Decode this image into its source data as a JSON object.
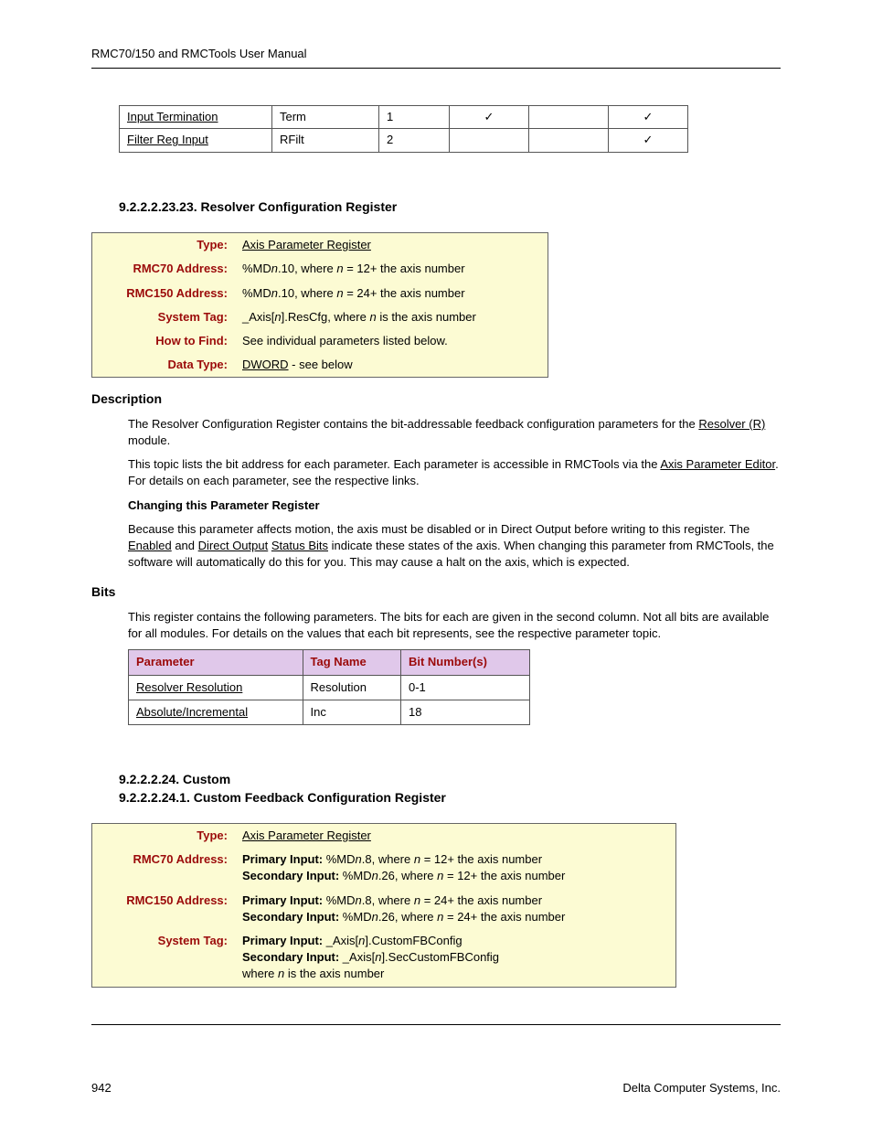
{
  "header": {
    "title": "RMC70/150 and RMCTools User Manual"
  },
  "topTable": {
    "rows": [
      {
        "param": "Input Termination",
        "tag": "Term",
        "bits": "1",
        "c1": "✓",
        "c2": "",
        "c3": "✓"
      },
      {
        "param": "Filter Reg Input",
        "tag": "RFilt",
        "bits": "2",
        "c1": "",
        "c2": "",
        "c3": "✓"
      }
    ]
  },
  "section1": {
    "heading": "9.2.2.2.23.23. Resolver Configuration Register",
    "box": {
      "type_label": "Type:",
      "type_val": "Axis Parameter Register",
      "rmc70_label": "RMC70 Address:",
      "rmc70_pre": "%MD",
      "rmc70_mid": ".10, where ",
      "rmc70_eq": " = 12+ the axis number",
      "rmc150_label": "RMC150 Address:",
      "rmc150_pre": "%MD",
      "rmc150_mid": ".10, where ",
      "rmc150_eq": " = 24+ the axis number",
      "systag_label": "System Tag:",
      "systag_pre": "_Axis[",
      "systag_post": "].ResCfg, where ",
      "systag_end": " is the axis number",
      "howto_label": "How to Find:",
      "howto_val": "See individual parameters listed below.",
      "datatype_label": "Data Type:",
      "datatype_link": "DWORD",
      "datatype_rest": " - see below"
    },
    "desc_h": "Description",
    "desc_p1a": "The Resolver Configuration Register contains the bit-addressable feedback configuration parameters for the ",
    "desc_p1_link": "Resolver (R)",
    "desc_p1b": " module.",
    "desc_p2a": "This topic lists the bit address for each parameter. Each parameter is accessible in RMCTools via the ",
    "desc_p2_link": "Axis Parameter Editor",
    "desc_p2b": ". For details on each parameter, see the respective links.",
    "change_h": "Changing this Parameter Register",
    "change_p_a": "Because this parameter affects motion, the axis must be disabled or in Direct Output before writing to this register. The ",
    "change_link1": "Enabled",
    "change_mid1": " and ",
    "change_link2": "Direct Output",
    "change_space": " ",
    "change_link3": "Status Bits",
    "change_p_b": " indicate these states of the axis. When changing this parameter from RMCTools, the software will automatically do this for you. This may cause a halt on the axis, which is expected.",
    "bits_h": "Bits",
    "bits_p": "This register contains the following parameters. The bits for each are given in the second column. Not all bits are available for all modules. For details on the values that each bit represents, see the respective parameter topic.",
    "bitsTable": {
      "h_param": "Parameter",
      "h_tag": "Tag Name",
      "h_bits": "Bit Number(s)",
      "rows": [
        {
          "param": "Resolver Resolution",
          "tag": "Resolution",
          "bits": "0-1"
        },
        {
          "param": "Absolute/Incremental",
          "tag": "Inc",
          "bits": "18"
        }
      ]
    }
  },
  "section2": {
    "heading1": "9.2.2.2.24. Custom",
    "heading2": "9.2.2.2.24.1. Custom Feedback Configuration Register",
    "box": {
      "type_label": "Type:",
      "type_val": "Axis Parameter Register",
      "rmc70_label": "RMC70 Address:",
      "rmc70_pi": "Primary Input:",
      "rmc70_pi_pre": " %MD",
      "rmc70_pi_mid": ".8, where ",
      "rmc70_pi_eq": " = 12+ the axis number",
      "rmc70_si": "Secondary Input:",
      "rmc70_si_pre": " %MD",
      "rmc70_si_mid": ".26, where ",
      "rmc70_si_eq": " = 12+ the axis number",
      "rmc150_label": "RMC150 Address:",
      "rmc150_pi": "Primary Input:",
      "rmc150_pi_pre": " %MD",
      "rmc150_pi_mid": ".8, where ",
      "rmc150_pi_eq": " = 24+ the axis number",
      "rmc150_si": "Secondary Input:",
      "rmc150_si_pre": " %MD",
      "rmc150_si_mid": ".26, where ",
      "rmc150_si_eq": " = 24+ the axis number",
      "systag_label": "System Tag:",
      "systag_pi": "Primary Input:",
      "systag_pi_val": " _Axis[",
      "systag_pi_end": "].CustomFBConfig",
      "systag_si": "Secondary Input:",
      "systag_si_val": " _Axis[",
      "systag_si_end": "].SecCustomFBConfig",
      "systag_where_a": "where ",
      "systag_where_b": " is the axis number"
    }
  },
  "n": "n",
  "footer": {
    "page": "942",
    "company": "Delta Computer Systems, Inc."
  }
}
